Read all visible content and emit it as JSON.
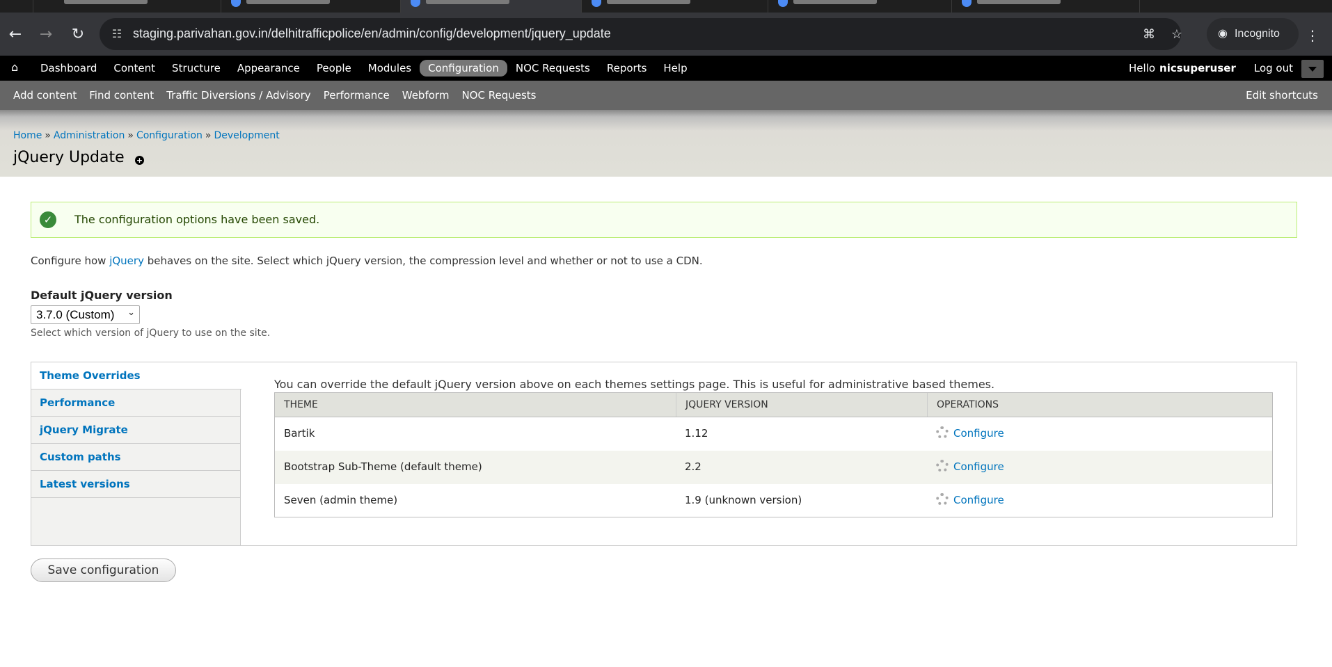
{
  "browser": {
    "url": "staging.parivahan.gov.in/delhitrafficpolice/en/admin/config/development/jquery_update",
    "incognito_label": "Incognito",
    "tab_count": 7
  },
  "admin_menu": {
    "items": [
      "Dashboard",
      "Content",
      "Structure",
      "Appearance",
      "People",
      "Modules",
      "Configuration",
      "NOC Requests",
      "Reports",
      "Help"
    ],
    "active": "Configuration",
    "hello_prefix": "Hello",
    "username": "nicsuperuser",
    "logout": "Log out"
  },
  "shortcuts": {
    "items": [
      "Add content",
      "Find content",
      "Traffic Diversions / Advisory",
      "Performance",
      "Webform",
      "NOC Requests"
    ],
    "edit": "Edit shortcuts"
  },
  "breadcrumb": {
    "items": [
      "Home",
      "Administration",
      "Configuration",
      "Development"
    ],
    "separator": "»"
  },
  "page_title": "jQuery Update",
  "status_message": "The configuration options have been saved.",
  "intro": {
    "before": "Configure how ",
    "link": "jQuery",
    "after": " behaves on the site. Select which jQuery version, the compression level and whether or not to use a CDN."
  },
  "version_field": {
    "label": "Default jQuery version",
    "value": "3.7.0 (Custom)",
    "description": "Select which version of jQuery to use on the site."
  },
  "vertical_tabs": [
    "Theme Overrides",
    "Performance",
    "jQuery Migrate",
    "Custom paths",
    "Latest versions"
  ],
  "selected_tab": "Theme Overrides",
  "theme_pane": {
    "description": "You can override the default jQuery version above on each themes settings page. This is useful for administrative based themes.",
    "headers": [
      "Theme",
      "jQuery Version",
      "Operations"
    ],
    "rows": [
      {
        "theme": "Bartik",
        "version": "1.12",
        "operation": "Configure"
      },
      {
        "theme": "Bootstrap Sub-Theme (default theme)",
        "version": "2.2",
        "operation": "Configure"
      },
      {
        "theme": "Seven (admin theme)",
        "version": "1.9 (unknown version)",
        "operation": "Configure"
      }
    ]
  },
  "save_button": "Save configuration",
  "colors": {
    "link": "#0074bd",
    "admin_bar": "#000000",
    "shortcut_bar": "#666666",
    "status_bg": "#f8fff0",
    "status_border": "#bbee77",
    "status_icon": "#3a8a3a"
  }
}
